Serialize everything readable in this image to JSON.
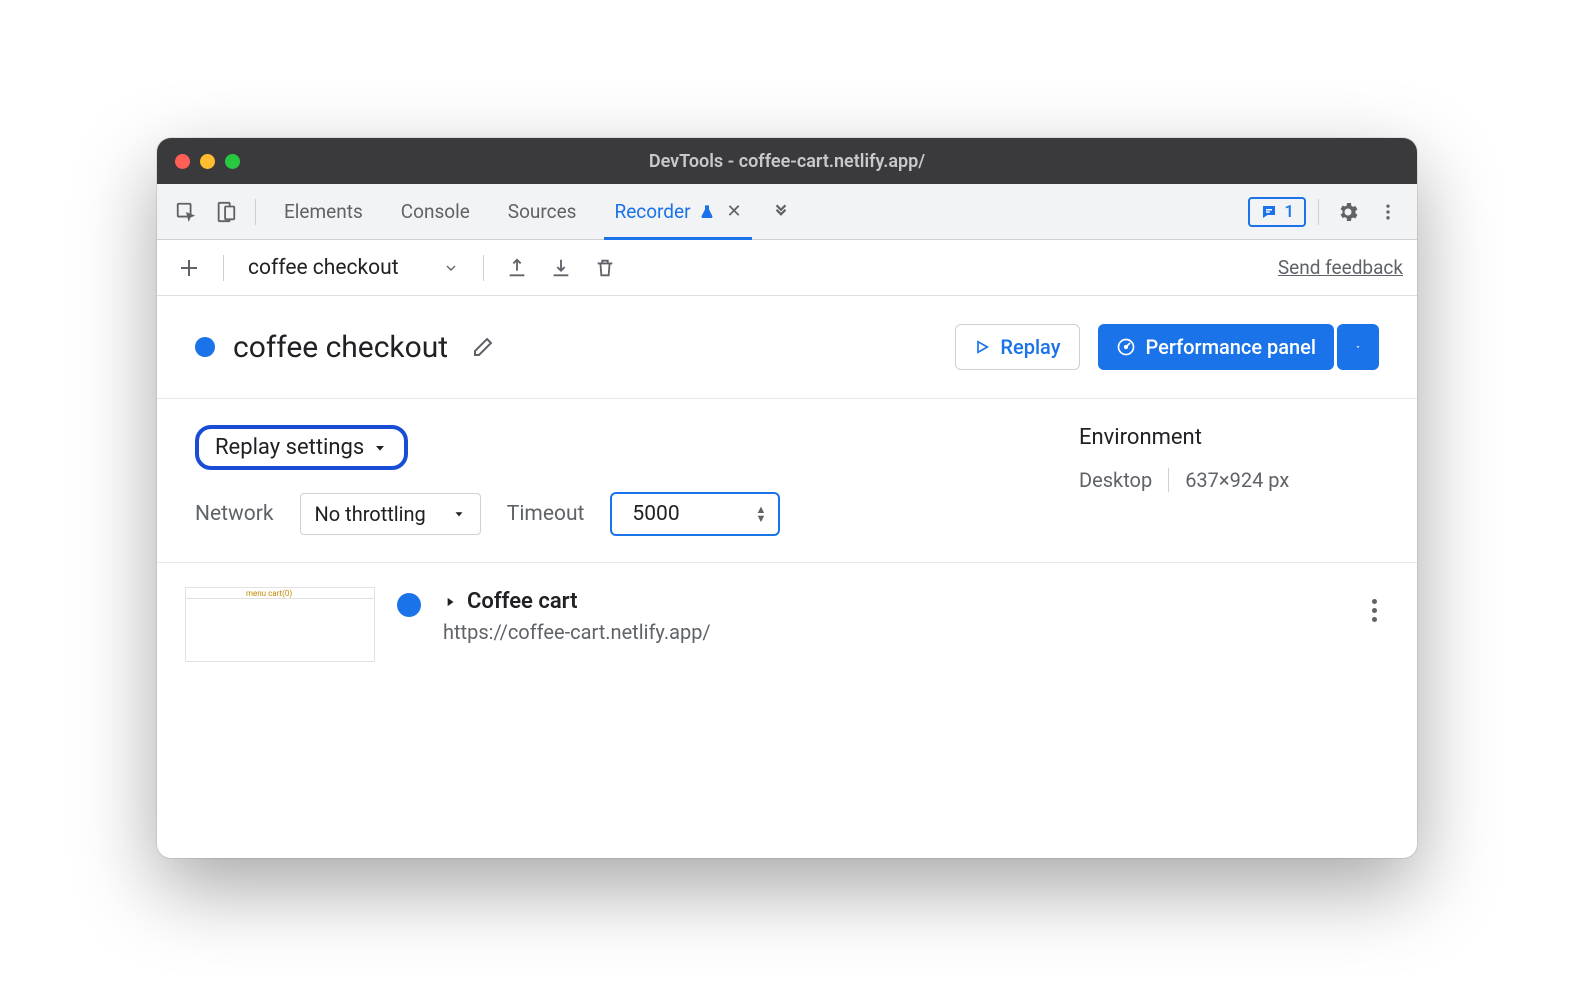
{
  "window": {
    "title": "DevTools - coffee-cart.netlify.app/"
  },
  "tabs": {
    "elements": "Elements",
    "console": "Console",
    "sources": "Sources",
    "recorder": "Recorder"
  },
  "issues_count": "1",
  "subbar": {
    "recording_name": "coffee checkout",
    "feedback": "Send feedback"
  },
  "header": {
    "title": "coffee checkout",
    "replay_btn": "Replay",
    "perf_btn": "Performance panel"
  },
  "settings": {
    "replay_settings_label": "Replay settings",
    "network_label": "Network",
    "throttling_value": "No throttling",
    "timeout_label": "Timeout",
    "timeout_value": "5000",
    "env_title": "Environment",
    "env_device": "Desktop",
    "env_dims": "637×924 px"
  },
  "step": {
    "title": "Coffee cart",
    "url": "https://coffee-cart.netlify.app/"
  }
}
